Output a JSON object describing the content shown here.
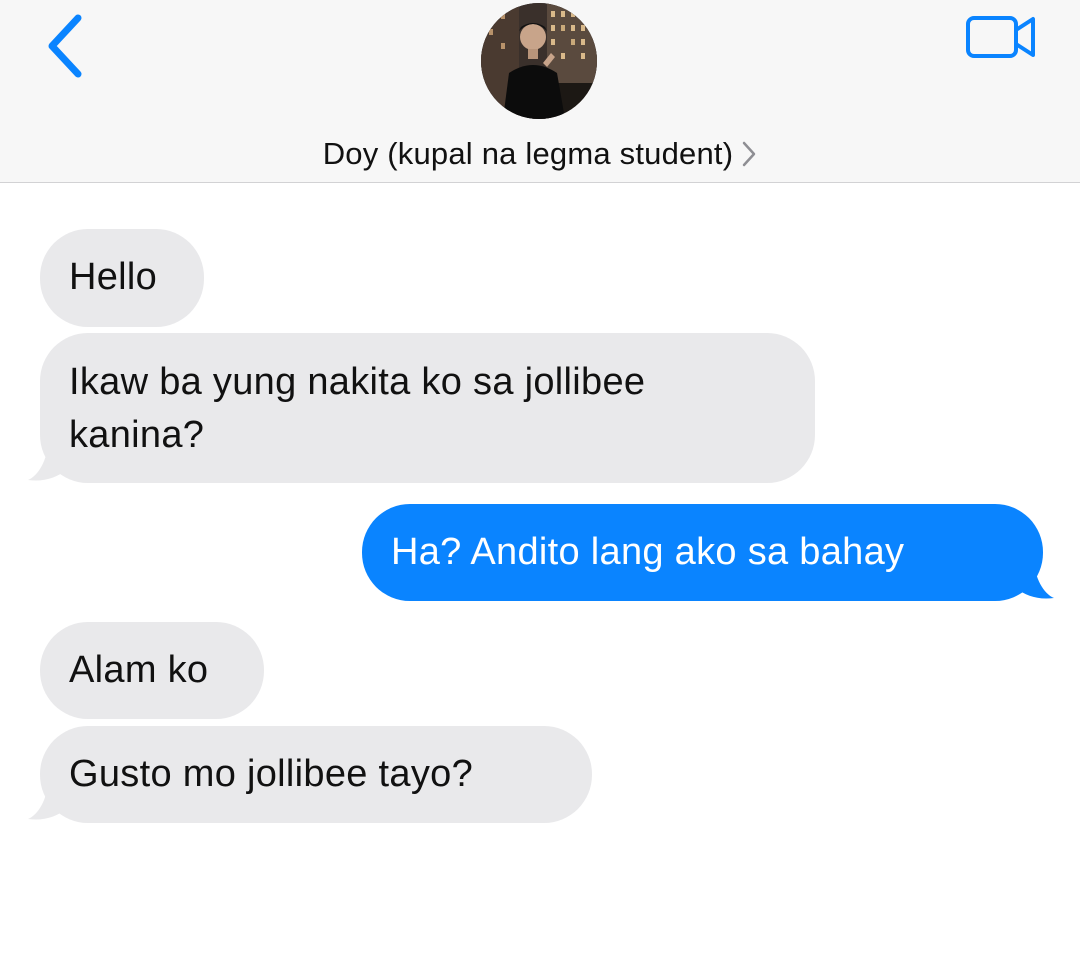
{
  "header": {
    "back_icon": "chevron-left-icon",
    "video_icon": "video-camera-icon",
    "contact_name": "Doy (kupal na legma student)",
    "contact_chevron": "chevron-right-icon",
    "accent_color": "#0a84ff"
  },
  "messages": [
    {
      "direction": "incoming",
      "text": "Hello"
    },
    {
      "direction": "incoming",
      "text": "Ikaw ba yung nakita ko sa jollibee kanina?"
    },
    {
      "direction": "outgoing",
      "text": "Ha? Andito lang ako sa bahay"
    },
    {
      "direction": "incoming",
      "text": "Alam ko"
    },
    {
      "direction": "incoming",
      "text": "Gusto mo jollibee tayo?"
    }
  ],
  "colors": {
    "incoming_bubble": "#e9e9eb",
    "outgoing_bubble": "#0a84ff",
    "header_bg": "#f7f7f7"
  }
}
